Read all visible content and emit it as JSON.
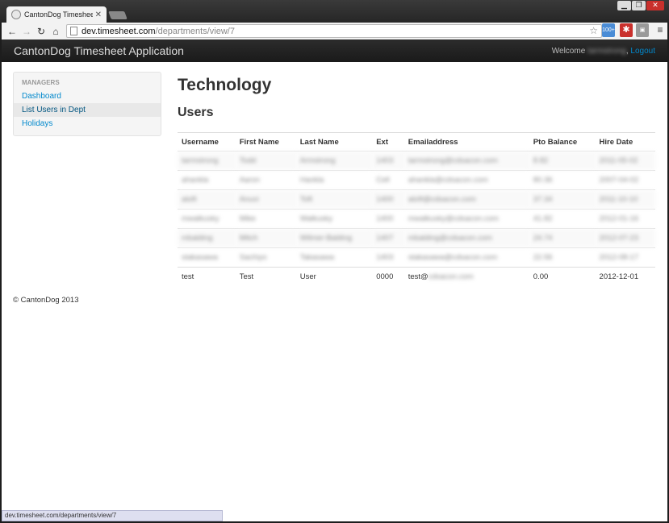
{
  "browser": {
    "tab_title": "CantonDog Timesheet Ap",
    "url_host": "dev.timesheet.com",
    "url_path": "/departments/view/7",
    "window_buttons": [
      "▁",
      "❐",
      "✕"
    ],
    "ext_badge": "100+",
    "status_url": "dev.timesheet.com/departments/view/7"
  },
  "app": {
    "brand": "CantonDog Timesheet Application",
    "welcome_label": "Welcome",
    "welcome_user": "tarmstrong",
    "logout_label": "Logout"
  },
  "sidebar": {
    "header": "MANAGERS",
    "items": [
      {
        "label": "Dashboard",
        "active": false
      },
      {
        "label": "List Users in Dept",
        "active": true
      },
      {
        "label": "Holidays",
        "active": false
      }
    ]
  },
  "main": {
    "department_title": "Technology",
    "section_title": "Users",
    "table": {
      "columns": [
        "Username",
        "First Name",
        "Last Name",
        "Ext",
        "Emailaddress",
        "Pto Balance",
        "Hire Date"
      ],
      "blurred_rows": [
        [
          "tarmstrong",
          "Todd",
          "Armstrong",
          "1403",
          "tarmstrong@cdsacon.com",
          "8.82",
          "2011-05-02"
        ],
        [
          "ahankla",
          "Aaron",
          "Hankla",
          "Cell",
          "ahankla@cdsacon.com",
          "80.36",
          "2007-04-02"
        ],
        [
          "atoft",
          "Anuvi",
          "Toft",
          "1400",
          "atoft@cdsacon.com",
          "37.34",
          "2011-10-10"
        ],
        [
          "mwalkusky",
          "Mike",
          "Walkusky",
          "1400",
          "mwalkusky@cdsacon.com",
          "41.82",
          "2012-01-16"
        ],
        [
          "mbalding",
          "Mitch",
          "Wilmer-Balding",
          "1407",
          "mbalding@cdsacon.com",
          "24.74",
          "2012-07-23"
        ],
        [
          "stakasawa",
          "Sachiyo",
          "Takasawa",
          "1403",
          "stakasawa@cdsacon.com",
          "22.56",
          "2012-08-17"
        ]
      ],
      "test_row": {
        "username": "test",
        "first_name": "Test",
        "last_name": "User",
        "ext": "0000",
        "email_prefix": "test@",
        "email_domain": "cdsacon.com",
        "pto": "0.00",
        "hire_date": "2012-12-01"
      }
    }
  },
  "footer": {
    "copyright": "© CantonDog 2013"
  }
}
